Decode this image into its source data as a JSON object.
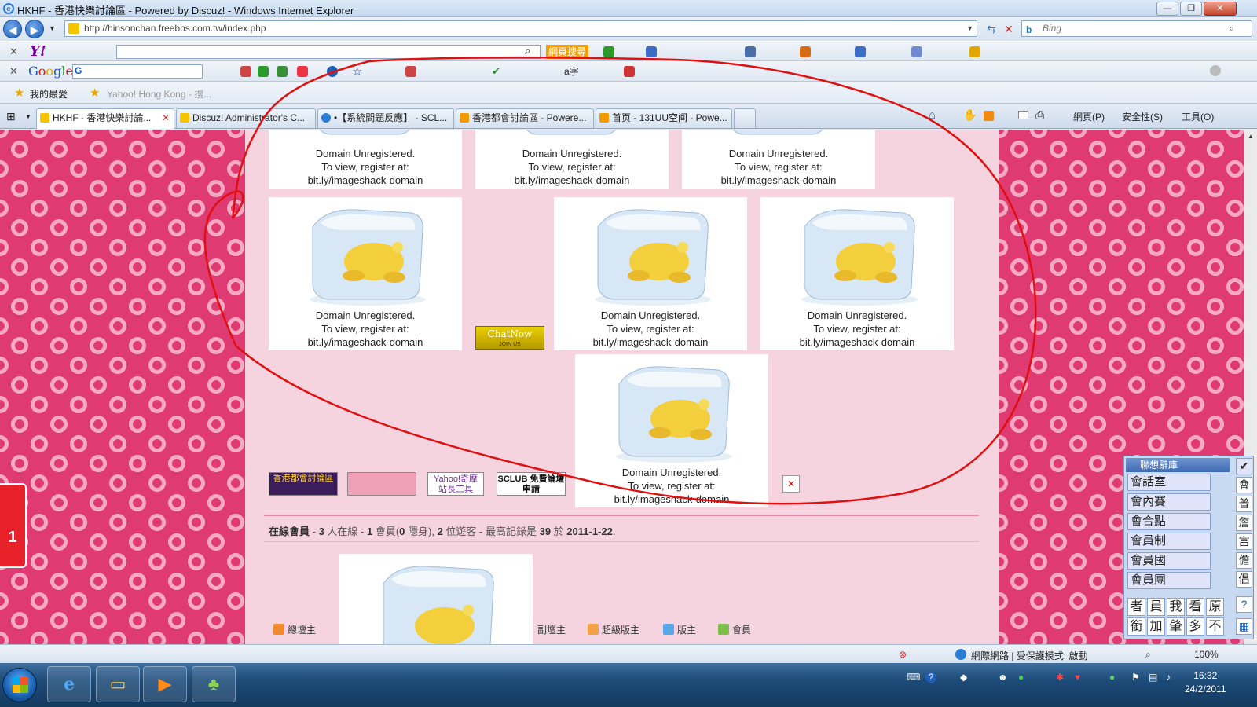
{
  "window": {
    "title": "HKHF - 香港快樂討論區 - Powered by Discuz! - Windows Internet Explorer",
    "minimize": "—",
    "restore": "❐",
    "close": "✕"
  },
  "address_bar": {
    "url": "http://hinsonchan.freebbs.com.tw/index.php",
    "search_engine": "Bing",
    "search_placeholder": "Bing"
  },
  "yahoo_toolbar": {
    "logo": "Y!",
    "search_button_label": "網頁搜尋"
  },
  "google_toolbar": {
    "logo_letters": [
      "G",
      "o",
      "o",
      "g",
      "l",
      "e"
    ],
    "field_prefix": "G"
  },
  "favorites_bar": {
    "favorites_label": "我的最愛",
    "link_label": "Yahoo! Hong Kong - 搜..."
  },
  "tabs": [
    {
      "label": "HKHF - 香港快樂討論...",
      "active": true
    },
    {
      "label": "Discuz! Administrator's C...",
      "active": false
    },
    {
      "label": "•【系統問題反應】 - SCL...",
      "active": false
    },
    {
      "label": "香港都會討論區 - Powere...",
      "active": false
    },
    {
      "label": "首页 - 131UU空间 - Powe...",
      "active": false
    }
  ],
  "command_bar": {
    "page": "網頁(P)",
    "safety": "安全性(S)",
    "tools": "工具(O)"
  },
  "page": {
    "image_caption_lines": [
      "Domain Unregistered.",
      "To view, register at:",
      "bit.ly/imageshack-domain"
    ],
    "chatnow_title": "ChatNow",
    "chatnow_sub": "JOIN US",
    "banners": [
      {
        "label": "香港都會討論區",
        "color": "#3b1d5c"
      },
      {
        "label": "",
        "color": "#f0a0b8"
      },
      {
        "label": "Yahoo!奇摩 站長工具",
        "color": "#ffffff"
      },
      {
        "label": "SCLUB 免費論壇申請",
        "color": "#ffffff"
      }
    ],
    "online": {
      "heading": "在線會員",
      "text_1": " - ",
      "online_count": "3",
      "text_2": " 人在線 - ",
      "member_count": "1",
      "text_3": " 會員(",
      "hidden_count": "0",
      "text_4": " 隱身), ",
      "guest_count": "2",
      "text_5": " 位遊客 - 最高記錄是 ",
      "record": "39",
      "text_6": " 於 ",
      "record_date": "2011-1-22",
      "text_7": "."
    },
    "legend": [
      {
        "label": "總壇主",
        "color": "#f08a2c"
      },
      {
        "label": "副壇主",
        "color": "#f08a2c"
      },
      {
        "label": "超級版主",
        "color": "#f2a244"
      },
      {
        "label": "版主",
        "color": "#58a6e6"
      },
      {
        "label": "會員",
        "color": "#7cc04a"
      }
    ],
    "side_widget_label": "1"
  },
  "ime": {
    "title": "聯想辭庫",
    "phrases": [
      "會話室",
      "會內賽",
      "會合點",
      "會員制",
      "會員國",
      "會員團"
    ],
    "chars_row1": [
      "者",
      "員",
      "我",
      "看",
      "原"
    ],
    "chars_row2": [
      "銜",
      "加",
      "肇",
      "多",
      "不"
    ],
    "side_chars": [
      "會",
      "普",
      "詹",
      "富",
      "儋",
      "倡"
    ]
  },
  "status_bar": {
    "zone": "網際網路 | 受保護模式: 啟動",
    "zoom": "100%"
  },
  "taskbar": {
    "time": "16:32",
    "date": "24/2/2011"
  },
  "colors": {
    "annotation": "#e01010",
    "page_bg": "#f6d4df",
    "side_pattern": "#e03a72"
  }
}
